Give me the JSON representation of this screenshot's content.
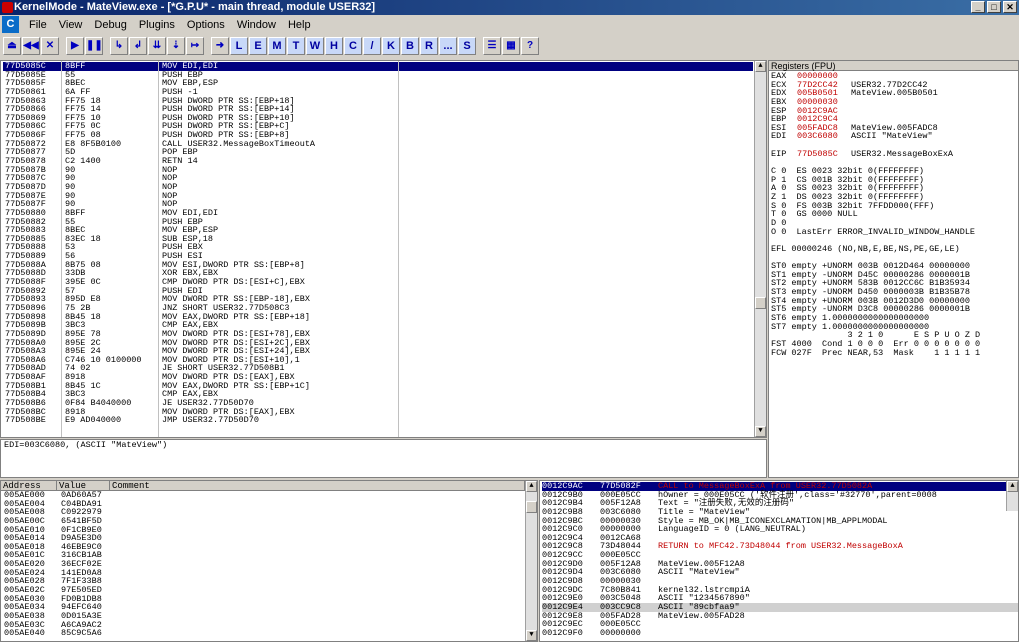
{
  "title": "KernelMode - MateView.exe - [*G.P.U* - main thread, module USER32]",
  "menu": [
    "File",
    "View",
    "Debug",
    "Plugins",
    "Options",
    "Window",
    "Help"
  ],
  "toolbar_glyphs": [
    "⏏",
    "◀◀",
    "✕",
    "▶",
    "❚❚",
    "↳",
    "↲",
    "⇊",
    "⇣",
    "↦",
    "➜"
  ],
  "toolbar_letters": [
    "L",
    "E",
    "M",
    "T",
    "W",
    "H",
    "C",
    "/",
    "K",
    "B",
    "R",
    "...",
    "S"
  ],
  "disasm": [
    [
      "77D5085C",
      "8BFF",
      "MOV EDI,EDI"
    ],
    [
      "77D5085E",
      "55",
      "PUSH EBP"
    ],
    [
      "77D5085F",
      "8BEC",
      "MOV EBP,ESP"
    ],
    [
      "77D50861",
      "6A FF",
      "PUSH -1"
    ],
    [
      "77D50863",
      "FF75 18",
      "PUSH DWORD PTR SS:[EBP+18]"
    ],
    [
      "77D50866",
      "FF75 14",
      "PUSH DWORD PTR SS:[EBP+14]"
    ],
    [
      "77D50869",
      "FF75 10",
      "PUSH DWORD PTR SS:[EBP+10]"
    ],
    [
      "77D5086C",
      "FF75 0C",
      "PUSH DWORD PTR SS:[EBP+C]"
    ],
    [
      "77D5086F",
      "FF75 08",
      "PUSH DWORD PTR SS:[EBP+8]"
    ],
    [
      "77D50872",
      "E8 8F5B0100",
      "CALL USER32.MessageBoxTimeoutA"
    ],
    [
      "77D50877",
      "5D",
      "POP EBP"
    ],
    [
      "77D50878",
      "C2 1400",
      "RETN 14"
    ],
    [
      "77D5087B",
      "90",
      "NOP"
    ],
    [
      "77D5087C",
      "90",
      "NOP"
    ],
    [
      "77D5087D",
      "90",
      "NOP"
    ],
    [
      "77D5087E",
      "90",
      "NOP"
    ],
    [
      "77D5087F",
      "90",
      "NOP"
    ],
    [
      "77D50880",
      "8BFF",
      "MOV EDI,EDI"
    ],
    [
      "77D50882",
      "55",
      "PUSH EBP"
    ],
    [
      "77D50883",
      "8BEC",
      "MOV EBP,ESP"
    ],
    [
      "77D50885",
      "83EC 18",
      "SUB ESP,18"
    ],
    [
      "77D50888",
      "53",
      "PUSH EBX"
    ],
    [
      "77D50889",
      "56",
      "PUSH ESI"
    ],
    [
      "77D5088A",
      "8B75 08",
      "MOV ESI,DWORD PTR SS:[EBP+8]"
    ],
    [
      "77D5088D",
      "33DB",
      "XOR EBX,EBX"
    ],
    [
      "77D5088F",
      "395E 0C",
      "CMP DWORD PTR DS:[ESI+C],EBX"
    ],
    [
      "77D50892",
      "57",
      "PUSH EDI"
    ],
    [
      "77D50893",
      "895D E8",
      "MOV DWORD PTR SS:[EBP-18],EBX"
    ],
    [
      "77D50896",
      "75 2B",
      "JNZ SHORT USER32.77D508C3"
    ],
    [
      "77D50898",
      "8B45 18",
      "MOV EAX,DWORD PTR SS:[EBP+18]"
    ],
    [
      "77D5089B",
      "3BC3",
      "CMP EAX,EBX"
    ],
    [
      "77D5089D",
      "895E 78",
      "MOV DWORD PTR DS:[ESI+78],EBX"
    ],
    [
      "77D508A0",
      "895E 2C",
      "MOV DWORD PTR DS:[ESI+2C],EBX"
    ],
    [
      "77D508A3",
      "895E 24",
      "MOV DWORD PTR DS:[ESI+24],EBX"
    ],
    [
      "77D508A6",
      "C746 10 0100000",
      "MOV DWORD PTR DS:[ESI+10],1"
    ],
    [
      "77D508AD",
      "74 02",
      "JE SHORT USER32.77D508B1"
    ],
    [
      "77D508AF",
      "8918",
      "MOV DWORD PTR DS:[EAX],EBX"
    ],
    [
      "77D508B1",
      "8B45 1C",
      "MOV EAX,DWORD PTR SS:[EBP+1C]"
    ],
    [
      "77D508B4",
      "3BC3",
      "CMP EAX,EBX"
    ],
    [
      "77D508B6",
      "0F84 B4040000",
      "JE USER32.77D50D70"
    ],
    [
      "77D508BC",
      "8918",
      "MOV DWORD PTR DS:[EAX],EBX"
    ],
    [
      "77D508BE",
      "E9 AD040000",
      "JMP USER32.77D50D70"
    ]
  ],
  "info_line": "EDI=003C6080, (ASCII \"MateView\")",
  "registers_title": "Registers (FPU)",
  "registers": [
    [
      "EAX",
      "00000000",
      ""
    ],
    [
      "ECX",
      "77D2CC42",
      "USER32.77D2CC42"
    ],
    [
      "EDX",
      "005B0501",
      "MateView.005B0501"
    ],
    [
      "EBX",
      "00000030",
      ""
    ],
    [
      "ESP",
      "0012C9AC",
      ""
    ],
    [
      "EBP",
      "0012C9C4",
      ""
    ],
    [
      "ESI",
      "005FADC8",
      "MateView.005FADC8"
    ],
    [
      "EDI",
      "003C6080",
      "ASCII \"MateView\""
    ]
  ],
  "eip": [
    "EIP",
    "77D5085C",
    "USER32.MessageBoxExA"
  ],
  "flags": [
    "C 0  ES 0023 32bit 0(FFFFFFFF)",
    "P 1  CS 001B 32bit 0(FFFFFFFF)",
    "A 0  SS 0023 32bit 0(FFFFFFFF)",
    "Z 1  DS 0023 32bit 0(FFFFFFFF)",
    "S 0  FS 003B 32bit 7FFDD000(FFF)",
    "T 0  GS 0000 NULL",
    "D 0",
    "O 0  LastErr ERROR_INVALID_WINDOW_HANDLE"
  ],
  "efl": "EFL 00000246 (NO,NB,E,BE,NS,PE,GE,LE)",
  "fpu": [
    "ST0 empty +UNORM 003B 0012D464 00000000",
    "ST1 empty -UNORM D45C 00000286 0000001B",
    "ST2 empty +UNORM 583B 0012CC6C B1B35934",
    "ST3 empty -UNORM D450 0000003B B1B35B78",
    "ST4 empty +UNORM 003B 0012D3D0 00000000",
    "ST5 empty -UNORM D3C8 00000286 0000001B",
    "ST6 empty 1.0000000000000000000",
    "ST7 empty 1.0000000000000000000"
  ],
  "fpu_bits_header": "               3 2 1 0      E S P U O Z D",
  "fst": "FST 4000  Cond 1 0 0 0  Err 0 0 0 0 0 0 0",
  "fcw": "FCW 027F  Prec NEAR,53  Mask    1 1 1 1 1",
  "dump_headers": [
    "Address",
    "Value",
    "Comment"
  ],
  "dump": [
    [
      "005AE000",
      "0AD60A57"
    ],
    [
      "005AE004",
      "C04BDA91"
    ],
    [
      "005AE008",
      "C0922979"
    ],
    [
      "005AE00C",
      "6541BF5D"
    ],
    [
      "005AE010",
      "0F1CB9E0"
    ],
    [
      "005AE014",
      "D9A5E3D0"
    ],
    [
      "005AE018",
      "46EBE9C0"
    ],
    [
      "005AE01C",
      "316CB1AB"
    ],
    [
      "005AE020",
      "36ECF02E"
    ],
    [
      "005AE024",
      "141ED0A8"
    ],
    [
      "005AE028",
      "7F1F33B8"
    ],
    [
      "005AE02C",
      "97E505ED"
    ],
    [
      "005AE030",
      "FD0B1DB8"
    ],
    [
      "005AE034",
      "94EFC640"
    ],
    [
      "005AE038",
      "0D015A3E"
    ],
    [
      "005AE03C",
      "A6CA9AC2"
    ],
    [
      "005AE040",
      "85C9C5A6"
    ]
  ],
  "stack": [
    [
      "0012C9AC",
      "77D5082F",
      "CALL to MessageBoxExA from USER32.77D5082A"
    ],
    [
      "0012C9B0",
      "000E05CC",
      "hOwner = 000E05CC ('软件注册',class='#32770',parent=0008"
    ],
    [
      "0012C9B4",
      "005F12A8",
      "Text = \"注册失败,无效的注册码\""
    ],
    [
      "0012C9B8",
      "003C6080",
      "Title = \"MateView\""
    ],
    [
      "0012C9BC",
      "00000030",
      "Style = MB_OK|MB_ICONEXCLAMATION|MB_APPLMODAL"
    ],
    [
      "0012C9C0",
      "00000000",
      "LanguageID = 0 (LANG_NEUTRAL)"
    ],
    [
      "0012C9C4",
      "0012CA68",
      ""
    ],
    [
      "0012C9C8",
      "73D48044",
      "RETURN to MFC42.73D48044 from USER32.MessageBoxA"
    ],
    [
      "0012C9CC",
      "000E05CC",
      ""
    ],
    [
      "0012C9D0",
      "005F12A8",
      "MateView.005F12A8"
    ],
    [
      "0012C9D4",
      "003C6080",
      "ASCII \"MateView\""
    ],
    [
      "0012C9D8",
      "00000030",
      ""
    ],
    [
      "0012C9DC",
      "7C80B841",
      "kernel32.lstrcmpiA"
    ],
    [
      "0012C9E0",
      "003C5048",
      "ASCII \"1234567890\""
    ],
    [
      "0012C9E4",
      "003CC9C8",
      "ASCII \"89cbfaa9\""
    ],
    [
      "0012C9E8",
      "005FAD28",
      "MateView.005FAD28"
    ],
    [
      "0012C9EC",
      "000E05CC",
      ""
    ],
    [
      "0012C9F0",
      "00000000",
      ""
    ]
  ],
  "colors": {
    "title_start": "#0a246a",
    "title_end": "#3a6ea5",
    "selection": "#000080",
    "changed": "#c00000"
  }
}
